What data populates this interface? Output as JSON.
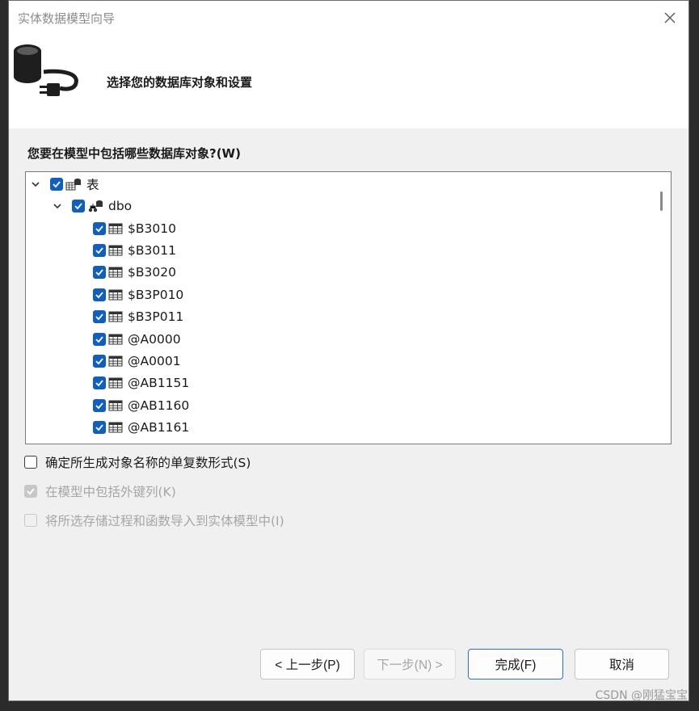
{
  "window": {
    "title": "实体数据模型向导"
  },
  "header": {
    "text": "选择您的数据库对象和设置"
  },
  "prompt": {
    "text": "您要在模型中包括哪些数据库对象?(W)"
  },
  "tree": {
    "root": {
      "label": "表",
      "checked": true
    },
    "schema": {
      "label": "dbo",
      "checked": true
    },
    "tables": [
      {
        "label": "$B3010",
        "checked": true
      },
      {
        "label": "$B3011",
        "checked": true
      },
      {
        "label": "$B3020",
        "checked": true
      },
      {
        "label": "$B3P010",
        "checked": true
      },
      {
        "label": "$B3P011",
        "checked": true
      },
      {
        "label": "@A0000",
        "checked": true
      },
      {
        "label": "@A0001",
        "checked": true
      },
      {
        "label": "@AB1151",
        "checked": true
      },
      {
        "label": "@AB1160",
        "checked": true
      },
      {
        "label": "@AB1161",
        "checked": true
      }
    ]
  },
  "options": [
    {
      "label": "确定所生成对象名称的单复数形式(S)",
      "checked": false,
      "enabled": true
    },
    {
      "label": "在模型中包括外键列(K)",
      "checked": true,
      "enabled": false
    },
    {
      "label": "将所选存储过程和函数导入到实体模型中(I)",
      "checked": false,
      "enabled": false
    }
  ],
  "buttons": {
    "back": "< 上一步(P)",
    "next": "下一步(N) >",
    "finish": "完成(F)",
    "cancel": "取消"
  },
  "watermark": "CSDN @刚猛宝宝"
}
